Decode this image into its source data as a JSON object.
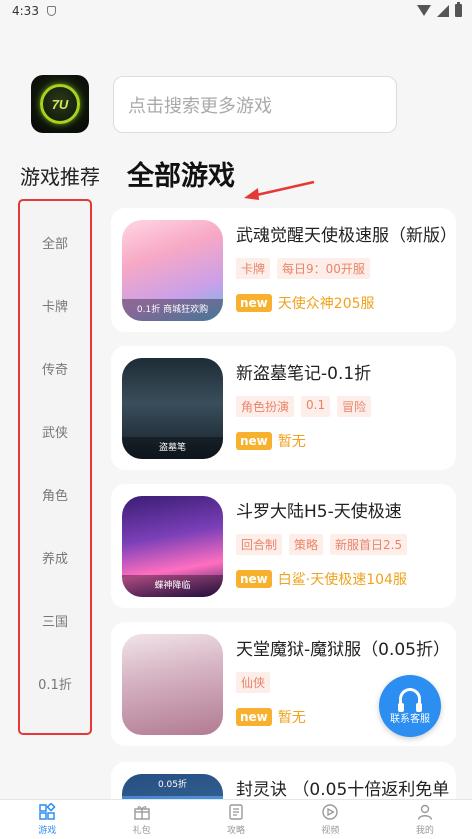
{
  "status_bar": {
    "time": "4:33"
  },
  "search": {
    "placeholder": "点击搜索更多游戏"
  },
  "headers": {
    "recommend": "游戏推荐",
    "all_games": "全部游戏"
  },
  "sidebar": {
    "items": [
      {
        "label": "全部"
      },
      {
        "label": "卡牌"
      },
      {
        "label": "传奇"
      },
      {
        "label": "武侠"
      },
      {
        "label": "角色"
      },
      {
        "label": "养成"
      },
      {
        "label": "三国"
      },
      {
        "label": "0.1折"
      }
    ]
  },
  "games": [
    {
      "title": "武魂觉醒天使极速服（新版）",
      "tags": [
        "卡牌",
        "每日9：00开服"
      ],
      "badge": "new",
      "server": "天使众神205服",
      "thumb_text": "0.1折 商城狂欢购"
    },
    {
      "title": "新盗墓笔记-0.1折",
      "tags": [
        "角色扮演",
        "0.1",
        "冒险"
      ],
      "badge": "new",
      "server": "暂无",
      "thumb_text": "盗墓笔"
    },
    {
      "title": "斗罗大陆H5-天使极速",
      "tags": [
        "回合制",
        "策略",
        "新服首日2.5"
      ],
      "badge": "new",
      "server": "白鲨·天使极速104服",
      "thumb_text": "蝶神降临"
    },
    {
      "title": "天堂魔狱-魔狱服（0.05折）",
      "tags": [
        "仙侠"
      ],
      "badge": "new",
      "server": "暂无",
      "thumb_text": ""
    },
    {
      "title": "封灵诀 （0.05十倍返利免单",
      "tags": [],
      "badge": "",
      "server": "",
      "thumb_text": "0.05折"
    }
  ],
  "customer_service": {
    "label": "联系客服"
  },
  "tabbar": {
    "items": [
      {
        "label": "游戏",
        "icon": "game-icon",
        "active": true
      },
      {
        "label": "礼包",
        "icon": "gift-icon",
        "active": false
      },
      {
        "label": "攻略",
        "icon": "guide-icon",
        "active": false
      },
      {
        "label": "视频",
        "icon": "video-icon",
        "active": false
      },
      {
        "label": "我的",
        "icon": "profile-icon",
        "active": false
      }
    ]
  },
  "colors": {
    "accent": "#2b8ef0",
    "highlight_border": "#e53935",
    "tag_text": "#e9846a",
    "server_text": "#f0a21c",
    "new_badge": "#f7b12e"
  }
}
